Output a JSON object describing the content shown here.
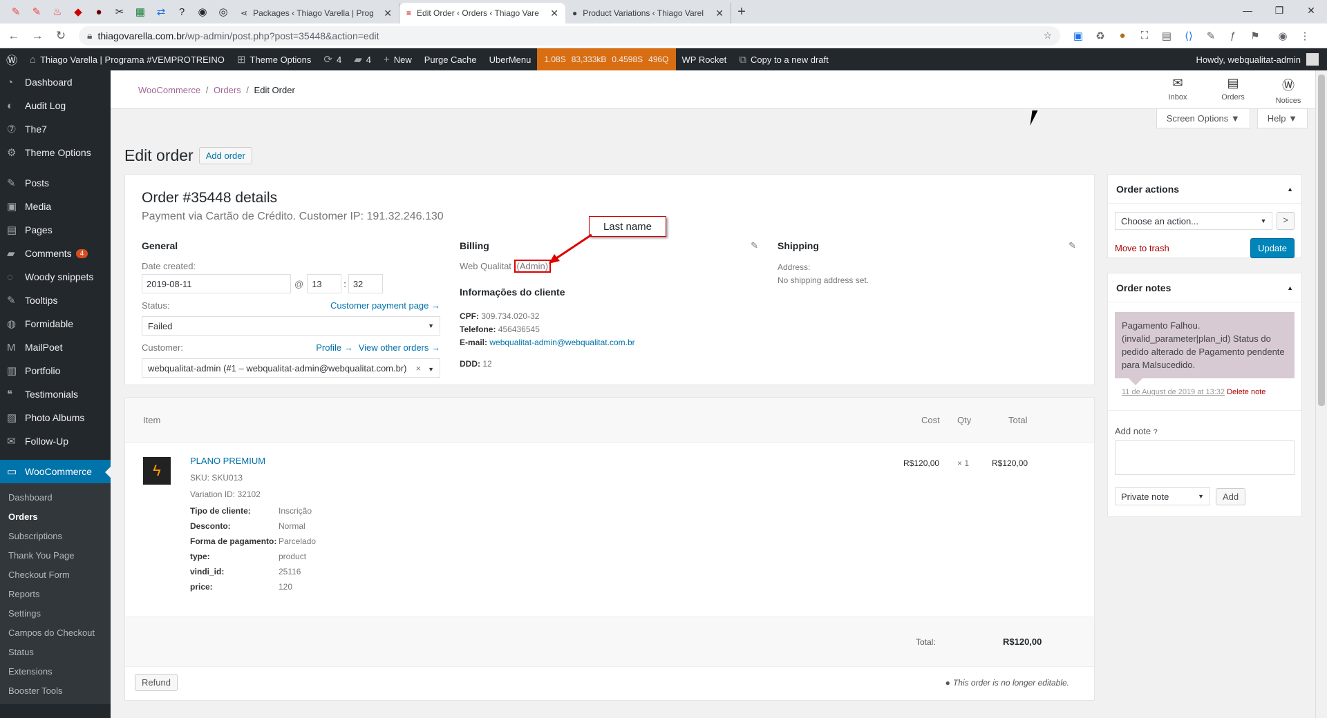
{
  "browser": {
    "pinned": [
      "wp-icon",
      "wp-icon",
      "fire-icon",
      "diamond-icon",
      "person-icon",
      "tools-icon",
      "sheet-icon",
      "translate-icon",
      "question-icon",
      "circle-icon",
      "circle-icon"
    ],
    "tabs": [
      {
        "title": "Packages ‹ Thiago Varella | Prog",
        "active": false
      },
      {
        "title": "Edit Order ‹ Orders ‹ Thiago Vare",
        "active": true
      },
      {
        "title": "Product Variations ‹ Thiago Varel",
        "active": false
      }
    ],
    "new_tab": "+",
    "url_host": "thiagovarella.com.br",
    "url_path": "/wp-admin/post.php?post=35448&action=edit"
  },
  "adminbar": {
    "site": "Thiago Varella | Programa #VEMPROTREINO",
    "theme_options": "Theme Options",
    "updates": "4",
    "comments": "4",
    "new": "New",
    "purge": "Purge Cache",
    "ubermenu": "UberMenu",
    "perf": [
      "1.08S",
      "83,333kB",
      "0.4598S",
      "496Q"
    ],
    "wprocket": "WP Rocket",
    "copy": "Copy to a new draft",
    "howdy": "Howdy, webqualitat-admin"
  },
  "sidebar": {
    "top": [
      "Dashboard",
      "Audit Log",
      "The7",
      "Theme Options"
    ],
    "main": [
      "Posts",
      "Media",
      "Pages",
      "Comments",
      "Woody snippets",
      "Tooltips",
      "Formidable",
      "MailPoet",
      "Portfolio",
      "Testimonials",
      "Photo Albums",
      "Follow-Up"
    ],
    "comments_badge": "4",
    "woo": "WooCommerce",
    "woo_sub": [
      "Dashboard",
      "Orders",
      "Subscriptions",
      "Thank You Page",
      "Checkout Form",
      "Reports",
      "Settings",
      "Campos do Checkout",
      "Status",
      "Extensions",
      "Booster Tools"
    ]
  },
  "header": {
    "crumb1": "WooCommerce",
    "sep": "/",
    "crumb2": "Orders",
    "crumb3": "Edit Order",
    "icons": [
      "Inbox",
      "Orders",
      "Notices"
    ],
    "screen_options": "Screen Options ▼",
    "help": "Help ▼"
  },
  "page": {
    "title": "Edit order",
    "add_order": "Add order"
  },
  "order": {
    "title": "Order #35448 details",
    "meta": "Payment via Cartão de Crédito. Customer IP: 191.32.246.130",
    "general": "General",
    "date_label": "Date created:",
    "date": "2019-08-11",
    "at": "@",
    "hour": "13",
    "colon": ":",
    "minute": "32",
    "status_label": "Status:",
    "customer_payment": "Customer payment page →",
    "status": "Failed",
    "customer_label": "Customer:",
    "profile": "Profile →",
    "view_orders": "View other orders →",
    "customer": "webqualitat-admin (#1 – webqualitat-admin@webqualitat.com.br)",
    "clear": "×",
    "billing": "Billing",
    "billing_name": "Web Qualitat",
    "billing_last": "(Admin)",
    "info_title": "Informações do cliente",
    "cpf_k": "CPF:",
    "cpf": "309.734.020-32",
    "tel_k": "Telefone:",
    "tel": "456436545",
    "email_k": "E-mail:",
    "email": "webqualitat-admin@webqualitat.com.br",
    "ddd_k": "DDD:",
    "ddd": "12",
    "shipping": "Shipping",
    "address_label": "Address:",
    "no_shipping": "No shipping address set.",
    "callout": "Last name"
  },
  "items": {
    "headers": {
      "item": "Item",
      "cost": "Cost",
      "qty": "Qty",
      "total": "Total"
    },
    "name": "PLANO PREMIUM",
    "sku": "SKU: SKU013",
    "variation": "Variation ID: 32102",
    "meta": [
      {
        "k": "Tipo de cliente:",
        "v": "Inscrição"
      },
      {
        "k": "Desconto:",
        "v": "Normal"
      },
      {
        "k": "Forma de pagamento:",
        "v": "Parcelado"
      },
      {
        "k": "type:",
        "v": "product"
      },
      {
        "k": "vindi_id:",
        "v": "25116"
      },
      {
        "k": "price:",
        "v": "120"
      }
    ],
    "cost": "R$120,00",
    "qty": "× 1",
    "line_total": "R$120,00",
    "total_label": "Total:",
    "total": "R$120,00",
    "refund": "Refund",
    "not_editable": "This order is no longer editable."
  },
  "actions": {
    "title": "Order actions",
    "choose": "Choose an action...",
    "go": ">",
    "trash": "Move to trash",
    "update": "Update"
  },
  "notes": {
    "title": "Order notes",
    "note": "Pagamento Falhou. (invalid_parameter|plan_id) Status do pedido alterado de Pagamento pendente para Malsucedido.",
    "date": "11 de August de 2019 at 13:32",
    "delete": "Delete note",
    "add_label": "Add note",
    "type": "Private note",
    "add": "Add"
  }
}
